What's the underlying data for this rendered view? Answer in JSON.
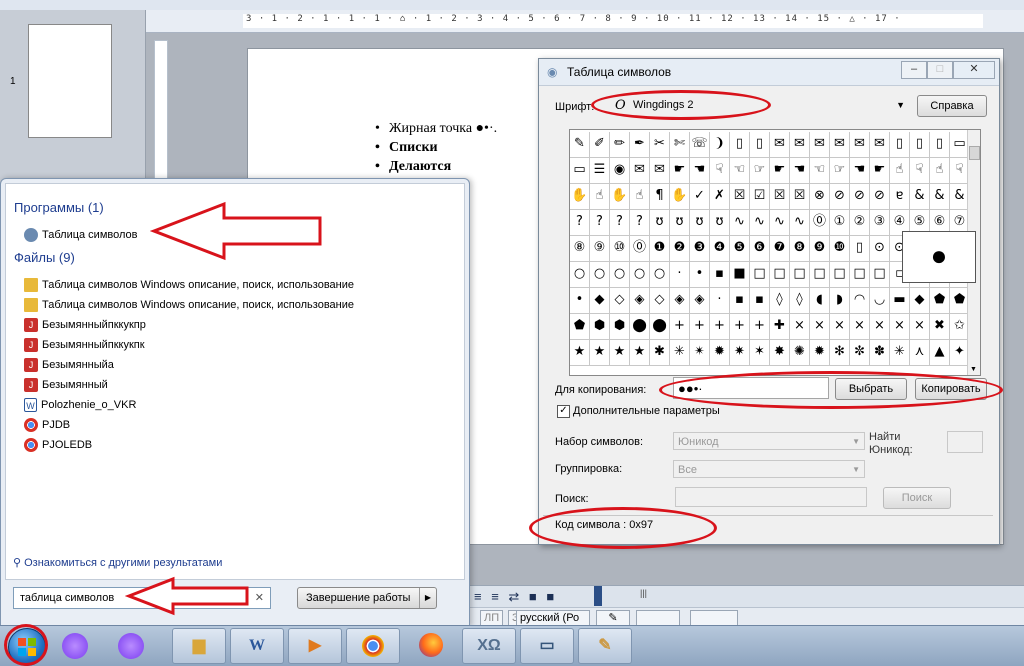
{
  "document": {
    "page_number": "1",
    "ruler_text": "3 · 1 · 2 · 1 · 1 · 1 · ⌂ · 1 · 2 · 3 · 4 · 5 · 6 · 7 · 8 · 9 · 10 · 11 · 12 · 13 · 14 · 15 · △ · 17 ·",
    "bullets": [
      {
        "text": "Жирная точка ●•·.",
        "bold": false
      },
      {
        "text": "Списки",
        "bold": true
      },
      {
        "text": "Делаются",
        "bold": true
      }
    ]
  },
  "statusbar": {
    "zam": "ЗАМ",
    "pp": "ЛП",
    "language": "русский (Ро",
    "grip": "|||"
  },
  "charmap": {
    "title": "Таблица символов",
    "font_label": "Шрифт:",
    "font_value": "Wingdings 2",
    "font_glyph": "O",
    "help_button": "Справка",
    "zoom_glyph": "●",
    "copy_label": "Для копирования:",
    "copy_value": "●●•·",
    "select_button": "Выбрать",
    "copy_button": "Копировать",
    "advanced_checkbox": "Дополнительные параметры",
    "charset_label": "Набор символов:",
    "charset_value": "Юникод",
    "unicode_label": "Найти\nЮникод:",
    "grouping_label": "Группировка:",
    "grouping_value": "Все",
    "search_label": "Поиск:",
    "search_button": "Поиск",
    "status": "Код символа : 0x97",
    "grid_rows": [
      [
        "✎",
        "✐",
        "✏",
        "✒",
        "✂",
        "✄",
        "☏",
        "❩",
        "▯",
        "▯",
        "✉",
        "✉",
        "✉",
        "✉",
        "✉",
        "✉",
        "▯",
        "▯",
        "▯",
        "▭"
      ],
      [
        "▭",
        "☰",
        "◉",
        "✉",
        "✉",
        "☛",
        "☚",
        "☟",
        "☜",
        "☞",
        "☛",
        "☚",
        "☜",
        "☞",
        "☚",
        "☛",
        "☝",
        "☟",
        "☝",
        "☟"
      ],
      [
        "✋",
        "☝",
        "✋",
        "☝",
        "¶",
        "✋",
        "✓",
        "✗",
        "☒",
        "☑",
        "☒",
        "☒",
        "⊗",
        "⊘",
        "⊘",
        "⊘",
        "ɐ",
        "&",
        "&",
        "&"
      ],
      [
        "?",
        "?",
        "?",
        "?",
        "ʊ",
        "ʊ",
        "ʊ",
        "ʊ",
        "∿",
        "∿",
        "∿",
        "∿",
        "⓪",
        "①",
        "②",
        "③",
        "④",
        "⑤",
        "⑥",
        "⑦"
      ],
      [
        "⑧",
        "⑨",
        "⑩",
        "⓪",
        "❶",
        "❷",
        "❸",
        "❹",
        "❺",
        "❻",
        "❼",
        "❽",
        "❾",
        "❿",
        "▯",
        "⊙",
        "⊙",
        "▯",
        "▯",
        "▯"
      ],
      [
        "○",
        "○",
        "○",
        "○",
        "○",
        "·",
        "•",
        "▪",
        "■",
        "□",
        "□",
        "□",
        "□",
        "□",
        "□",
        "□",
        "▫",
        "▪",
        "▪",
        "▪"
      ],
      [
        "•",
        "◆",
        "◇",
        "◈",
        "◇",
        "◈",
        "◈",
        "·",
        "▪",
        "▪",
        "◊",
        "◊",
        "◖",
        "◗",
        "◠",
        "◡",
        "▬",
        "◆",
        "⬟",
        "⬟"
      ],
      [
        "⬟",
        "⬢",
        "⬢",
        "⬤",
        "⬤",
        "+",
        "+",
        "+",
        "+",
        "+",
        "✚",
        "×",
        "×",
        "×",
        "×",
        "×",
        "×",
        "×",
        "✖",
        "✩"
      ],
      [
        "★",
        "★",
        "★",
        "★",
        "✱",
        "✳",
        "✴",
        "✹",
        "✷",
        "✶",
        "✸",
        "✺",
        "✹",
        "✻",
        "✼",
        "✽",
        "✳",
        "⋏",
        "▲",
        "✦"
      ]
    ]
  },
  "startmenu": {
    "programs_heading": "Программы (1)",
    "programs": [
      "Таблица символов"
    ],
    "files_heading": "Файлы (9)",
    "files": [
      {
        "name": "Таблица символов Windows описание, поиск, использование",
        "icon": "folder-icon"
      },
      {
        "name": "Таблица символов Windows описание, поиск, использование",
        "icon": "folder-icon"
      },
      {
        "name": "Безымянныйпккукпр",
        "icon": "picture-file-icon"
      },
      {
        "name": "Безымянныйпккукпк",
        "icon": "picture-file-icon"
      },
      {
        "name": "Безымянныйа",
        "icon": "picture-file-icon"
      },
      {
        "name": "Безымянный",
        "icon": "picture-file-icon"
      },
      {
        "name": "Polozhenie_o_VKR",
        "icon": "word-document-icon"
      },
      {
        "name": "PJDB",
        "icon": "chrome-icon"
      },
      {
        "name": "PJOLEDB",
        "icon": "chrome-icon"
      }
    ],
    "more_results": "Ознакомиться с другими результатами",
    "search_value": "таблица символов",
    "shutdown_button": "Завершение работы"
  },
  "taskbar": {
    "items": [
      "alice-assistant-icon",
      "microphone-icon",
      "file-explorer-icon",
      "word-icon",
      "media-player-icon",
      "chrome-icon",
      "firefox-icon",
      "character-map-icon",
      "computer-icon",
      "paint-icon"
    ],
    "word_label": "W"
  },
  "colors": {
    "annotation_red": "#d8131b",
    "taskbar": "#9fb4cc",
    "startmenu_heading": "#1e3d8f"
  }
}
